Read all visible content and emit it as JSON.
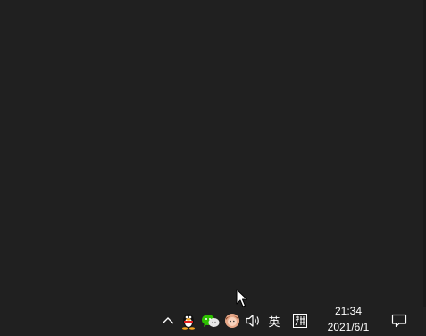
{
  "taskbar": {
    "tray": {
      "chevron_icon": "chevron-up-icon",
      "apps": [
        "qq-penguin-icon",
        "wechat-icon",
        "avatar-app-icon"
      ],
      "volume_icon": "speaker-volume-icon",
      "language": "英",
      "ime_icon": "pinyin-ime-icon"
    },
    "clock": {
      "time": "21:34",
      "date": "2021/6/1"
    },
    "notification_icon": "action-center-icon"
  },
  "colors": {
    "background": "#202020",
    "text": "#ffffff",
    "wechat_green": "#2dc100"
  }
}
